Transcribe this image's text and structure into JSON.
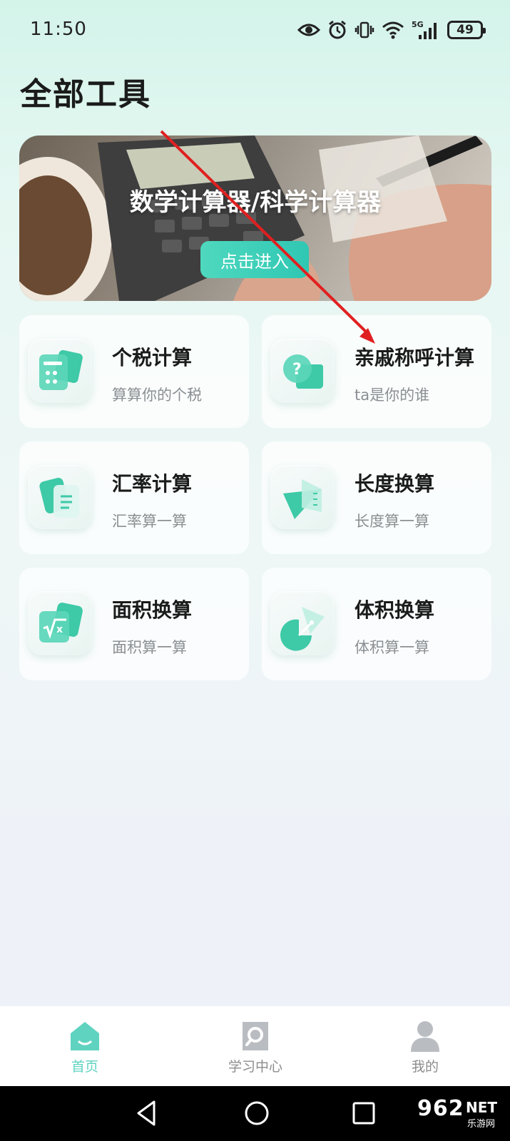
{
  "status_bar": {
    "time": "11:50",
    "battery": "49"
  },
  "page_title": "全部工具",
  "banner": {
    "title": "数学计算器/科学计算器",
    "button_label": "点击进入"
  },
  "tools": [
    {
      "name": "个税计算",
      "desc": "算算你的个税",
      "icon": "tax-calculator-icon"
    },
    {
      "name": "亲戚称呼计算",
      "desc": "ta是你的谁",
      "icon": "question-bubble-icon"
    },
    {
      "name": "汇率计算",
      "desc": "汇率算一算",
      "icon": "exchange-document-icon"
    },
    {
      "name": "长度换算",
      "desc": "长度算一算",
      "icon": "ruler-triangle-icon"
    },
    {
      "name": "面积换算",
      "desc": "面积算一算",
      "icon": "square-root-icon"
    },
    {
      "name": "体积换算",
      "desc": "体积算一算",
      "icon": "volume-geometry-icon"
    }
  ],
  "bottom_nav": [
    {
      "label": "首页",
      "icon": "home-icon",
      "active": true
    },
    {
      "label": "学习中心",
      "icon": "search-document-icon",
      "active": false
    },
    {
      "label": "我的",
      "icon": "user-icon",
      "active": false
    }
  ],
  "watermark": {
    "number": "962",
    "net": "NET",
    "cn": "乐游网"
  },
  "colors": {
    "accent": "#2fc7b3",
    "icon_green": "#3ec9a7",
    "arrow": "#e02020"
  }
}
